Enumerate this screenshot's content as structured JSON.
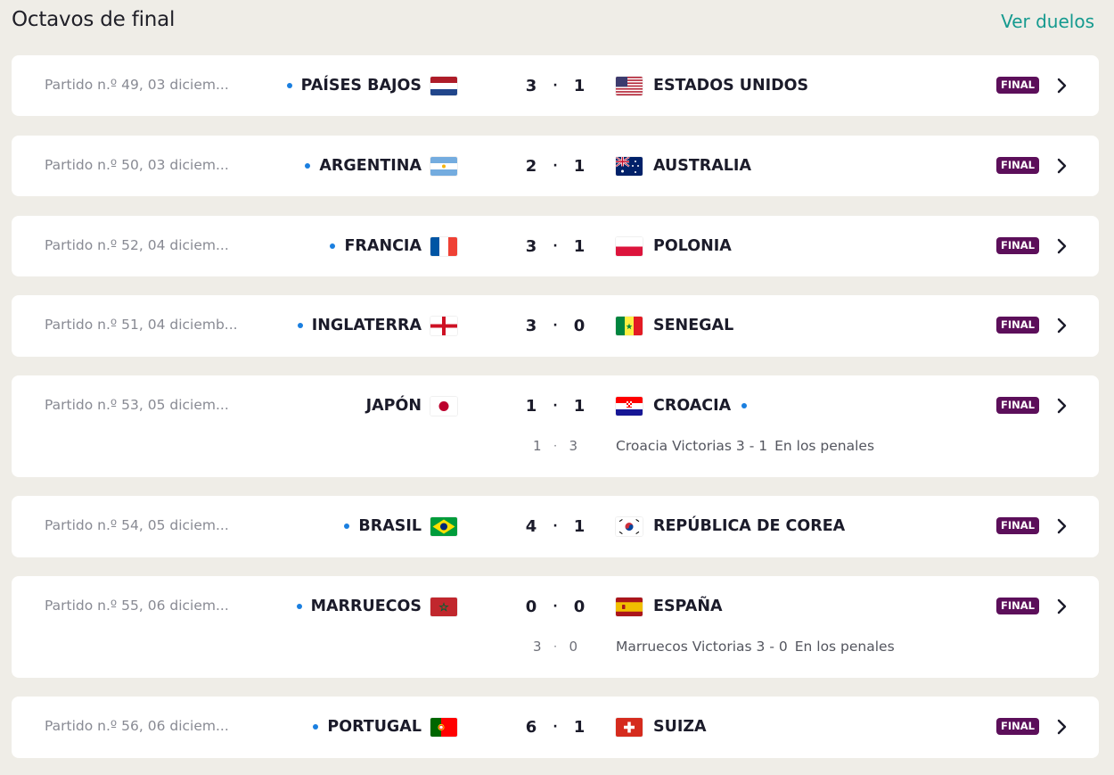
{
  "header": {
    "title": "Octavos de final",
    "link_label": "Ver duelos"
  },
  "status_badge": "FINAL",
  "matches": [
    {
      "info": "Partido n.º 49, 03 diciem...",
      "home": "PAÍSES BAJOS",
      "home_flag": "netherlands-flag",
      "home_score": "3",
      "away_score": "1",
      "away": "ESTADOS UNIDOS",
      "away_flag": "usa-flag",
      "winner": "home"
    },
    {
      "info": "Partido n.º 50, 03 diciem...",
      "home": "ARGENTINA",
      "home_flag": "argentina-flag",
      "home_score": "2",
      "away_score": "1",
      "away": "AUSTRALIA",
      "away_flag": "australia-flag",
      "winner": "home"
    },
    {
      "info": "Partido n.º 52, 04 diciem...",
      "home": "FRANCIA",
      "home_flag": "france-flag",
      "home_score": "3",
      "away_score": "1",
      "away": "POLONIA",
      "away_flag": "poland-flag",
      "winner": "home"
    },
    {
      "info": "Partido n.º 51, 04 diciemb...",
      "home": "INGLATERRA",
      "home_flag": "england-flag",
      "home_score": "3",
      "away_score": "0",
      "away": "SENEGAL",
      "away_flag": "senegal-flag",
      "winner": "home"
    },
    {
      "info": "Partido n.º 53, 05 diciem...",
      "home": "JAPÓN",
      "home_flag": "japan-flag",
      "home_score": "1",
      "away_score": "1",
      "away": "CROACIA",
      "away_flag": "croatia-flag",
      "winner": "away",
      "penalties": {
        "home": "1",
        "away": "3",
        "result": "Croacia Victorias 3 - 1",
        "note": "En los penales"
      }
    },
    {
      "info": "Partido n.º 54, 05 diciem...",
      "home": "BRASIL",
      "home_flag": "brazil-flag",
      "home_score": "4",
      "away_score": "1",
      "away": "REPÚBLICA DE COREA",
      "away_flag": "korea-flag",
      "winner": "home"
    },
    {
      "info": "Partido n.º 55, 06 diciem...",
      "home": "MARRUECOS",
      "home_flag": "morocco-flag",
      "home_score": "0",
      "away_score": "0",
      "away": "ESPAÑA",
      "away_flag": "spain-flag",
      "winner": "home",
      "penalties": {
        "home": "3",
        "away": "0",
        "result": "Marruecos Victorias 3 - 0",
        "note": "En los penales"
      }
    },
    {
      "info": "Partido n.º 56, 06 diciem...",
      "home": "PORTUGAL",
      "home_flag": "portugal-flag",
      "home_score": "6",
      "away_score": "1",
      "away": "SUIZA",
      "away_flag": "switzerland-flag",
      "winner": "home"
    }
  ]
}
